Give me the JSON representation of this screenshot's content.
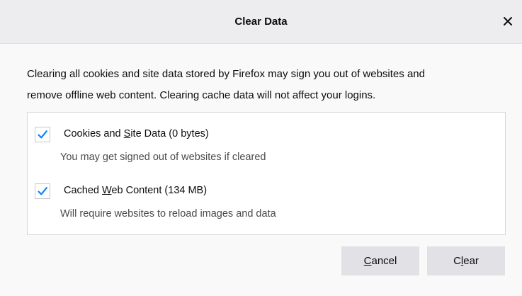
{
  "dialog": {
    "title": "Clear Data",
    "close_icon": "close-icon",
    "description_line1": "Clearing all cookies and site data stored by Firefox may sign you out of websites and",
    "description_line2": "remove offline web content. Clearing cache data will not affect your logins."
  },
  "options": [
    {
      "label_pre": "Cookies and ",
      "label_accesskey": "S",
      "label_post": "ite Data (0 bytes)",
      "note": "You may get signed out of websites if cleared",
      "checked": true
    },
    {
      "label_pre": "Cached ",
      "label_accesskey": "W",
      "label_post": "eb Content (134 MB)",
      "note": "Will require websites to reload images and data",
      "checked": true
    }
  ],
  "buttons": {
    "cancel_accesskey": "C",
    "cancel_rest": "ancel",
    "clear_pre": "C",
    "clear_accesskey": "l",
    "clear_post": "ear"
  },
  "colors": {
    "checkmark": "#0a84ff",
    "titlebar": "#ededf0",
    "button": "#e2e2e6"
  }
}
